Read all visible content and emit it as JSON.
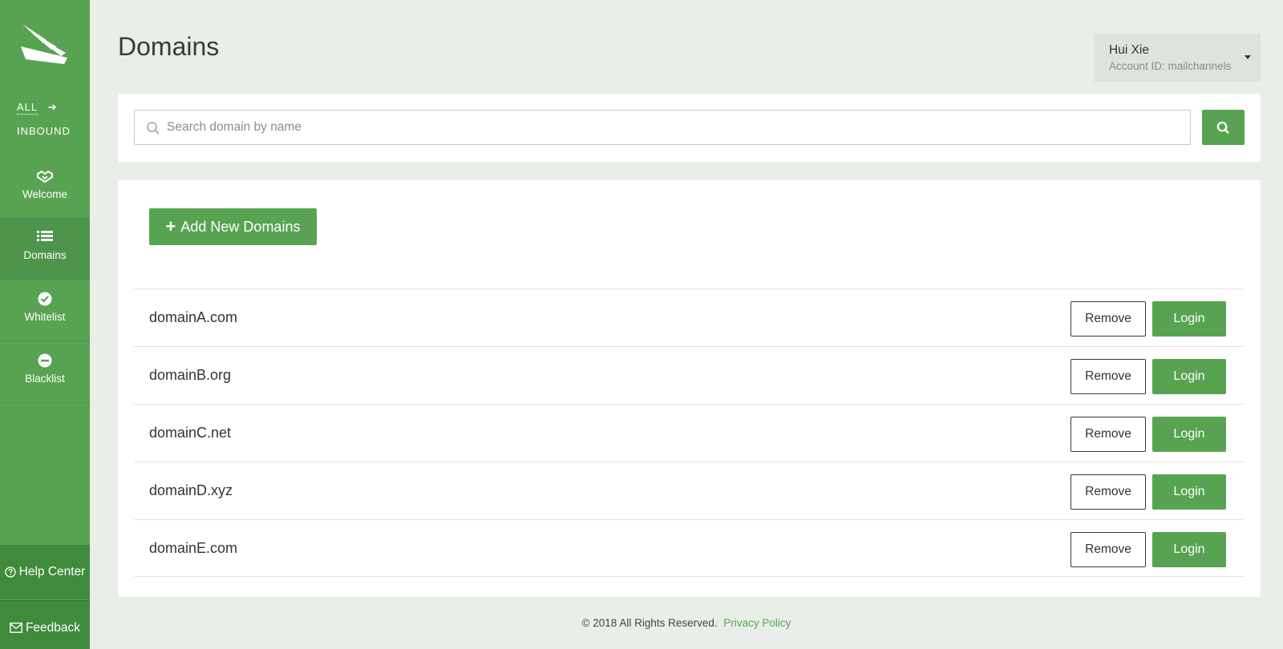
{
  "brand": {
    "accent": "#58a352",
    "accent_dark": "#3f8a3b"
  },
  "sidebar": {
    "logo": "wings-logo",
    "scope": {
      "all": "ALL",
      "arrow_icon": "arrow-right-icon",
      "inbound": "INBOUND"
    },
    "items": [
      {
        "label": "Welcome",
        "icon": "handshake-icon"
      },
      {
        "label": "Domains",
        "icon": "list-icon",
        "active": true
      },
      {
        "label": "Whitelist",
        "icon": "check-circle-icon"
      },
      {
        "label": "Blacklist",
        "icon": "minus-circle-icon"
      }
    ],
    "help_center": {
      "label": "Help Center",
      "icon": "question-circle-icon"
    },
    "feedback": {
      "label": "Feedback",
      "icon": "envelope-icon"
    }
  },
  "header": {
    "title": "Domains",
    "account": {
      "name": "Hui Xie",
      "account_id": "Account ID: mailchannels"
    }
  },
  "search": {
    "placeholder": "Search domain by name",
    "value": ""
  },
  "main": {
    "add_button": "Add New Domains",
    "domains": [
      {
        "name": "domainA.com"
      },
      {
        "name": "domainB.org"
      },
      {
        "name": "domainC.net"
      },
      {
        "name": "domainD.xyz"
      },
      {
        "name": "domainE.com"
      }
    ],
    "remove_label": "Remove",
    "login_label": "Login"
  },
  "footer": {
    "copyright": "© 2018 All Rights Reserved.",
    "privacy_link": "Privacy Policy"
  }
}
